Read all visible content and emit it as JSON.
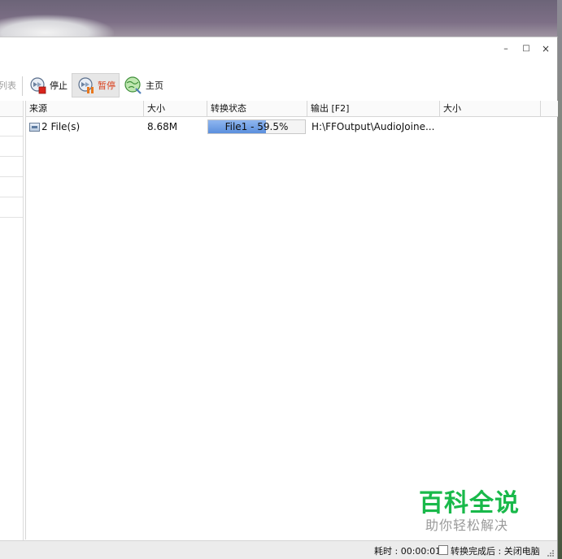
{
  "window": {
    "controls": {
      "minimize": "–",
      "maximize": "□",
      "close": "×"
    }
  },
  "toolbar": {
    "list_label": "列表",
    "stop_label": "停止",
    "pause_label": "暂停",
    "home_label": "主页",
    "icons": {
      "stop": "stop-icon",
      "pause": "pause-icon",
      "home": "home-globe-icon"
    },
    "pause_color": "#d8401c"
  },
  "table": {
    "columns": [
      "来源",
      "大小",
      "转换状态",
      "输出 [F2]",
      "大小"
    ],
    "rows": [
      {
        "source": "2 File(s)",
        "size": "8.68M",
        "status_text": "File1 - 59.5%",
        "progress": 0.595,
        "output": "H:\\FFOutput\\AudioJoine..."
      }
    ]
  },
  "watermark": {
    "main": "百科全说",
    "sub": "助你轻松解决",
    "color": "#19b94a"
  },
  "statusbar": {
    "elapsed": "耗时 : 00:00:01",
    "after_convert_label": "转换完成后 : 关闭电脑",
    "after_convert_checked": false
  }
}
